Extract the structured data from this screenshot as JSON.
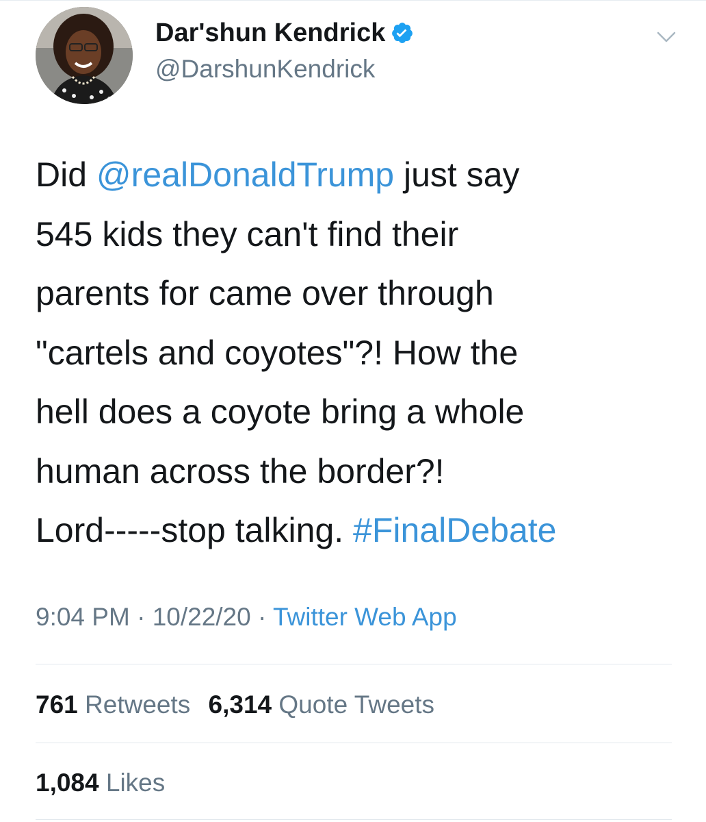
{
  "author": {
    "display_name": "Dar'shun Kendrick",
    "handle": "@DarshunKendrick",
    "verified": true,
    "avatar_icon": "profile-photo"
  },
  "menu_icon": "chevron-down-icon",
  "tweet": {
    "lines": [
      {
        "parts": [
          {
            "text": "Did ",
            "link": false
          },
          {
            "text": "@realDonaldTrump",
            "link": true
          },
          {
            "text": " just say",
            "link": false
          }
        ]
      },
      {
        "parts": [
          {
            "text": "545 kids they can't find their",
            "link": false
          }
        ]
      },
      {
        "parts": [
          {
            "text": "parents for came over through",
            "link": false
          }
        ]
      },
      {
        "parts": [
          {
            "text": "\"cartels and coyotes\"?! How the",
            "link": false
          }
        ]
      },
      {
        "parts": [
          {
            "text": "hell does a coyote bring a whole",
            "link": false
          }
        ]
      },
      {
        "parts": [
          {
            "text": "human across the border?!",
            "link": false
          }
        ]
      },
      {
        "parts": [
          {
            "text": "Lord-----stop talking. ",
            "link": false
          },
          {
            "text": "#FinalDebate",
            "link": true
          }
        ]
      }
    ]
  },
  "meta": {
    "time": "9:04 PM",
    "separator": " · ",
    "date": "10/22/20",
    "source": "Twitter Web App"
  },
  "stats": {
    "retweets_count": "761",
    "retweets_label": "Retweets",
    "quotes_count": "6,314",
    "quotes_label": "Quote Tweets",
    "likes_count": "1,084",
    "likes_label": "Likes"
  },
  "colors": {
    "text": "#14171a",
    "secondary": "#657786",
    "link": "#3b94d9",
    "verified": "#1da1f2",
    "divider": "#e1e8ed"
  }
}
